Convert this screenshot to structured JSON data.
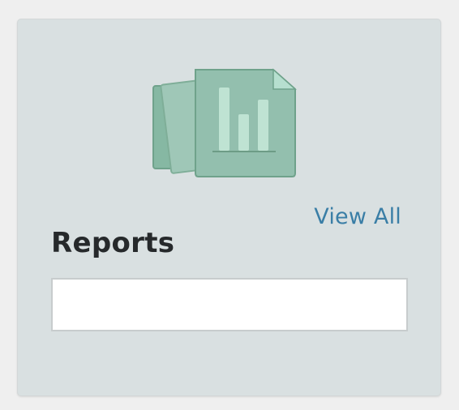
{
  "card": {
    "title": "Reports",
    "view_all_label": "View All",
    "input": {
      "value": "",
      "placeholder": ""
    }
  },
  "illustration": {
    "icon": "reports-documents-bar-chart-icon",
    "colors": {
      "page_back": "#86b8a3",
      "page_middle": "#9fc7b7",
      "page_front": "#93bfae",
      "page_stroke": "#6fa28b",
      "bars": "#bfe3d3",
      "folded_corner": "#b6dfcf"
    }
  },
  "colors": {
    "background": "#efefef",
    "card_background": "#d9e0e1",
    "link": "#3a7ea6",
    "title_text": "#26292b"
  }
}
